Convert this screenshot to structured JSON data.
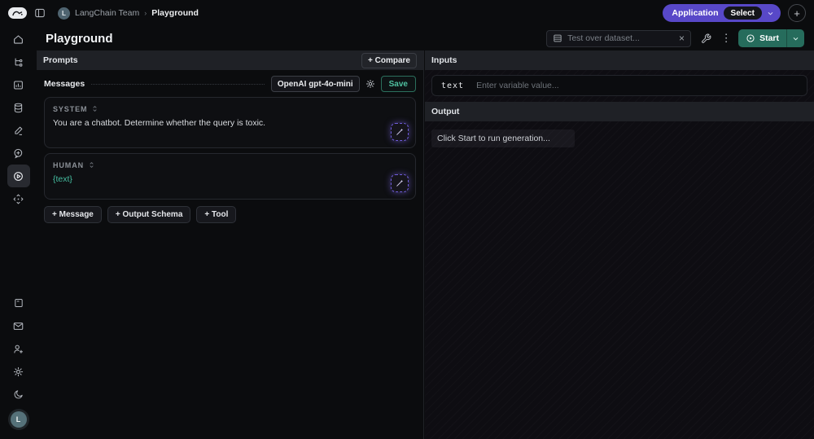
{
  "colors": {
    "accent_purple": "#5848c8",
    "accent_green": "#266c5c",
    "accent_teal": "#45bda0",
    "panel_header_bg": "#1f2126",
    "background": "#0b0c0e"
  },
  "topbar": {
    "breadcrumb": {
      "team_avatar_initial": "L",
      "team": "LangChain Team",
      "separator": "›",
      "current": "Playground"
    },
    "application_button": {
      "label": "Application",
      "select": "Select"
    },
    "add_button": "+"
  },
  "header": {
    "title": "Playground",
    "dataset_input_placeholder": "Test over dataset...",
    "clear_icon": "×",
    "more_icon": "⋮",
    "start_button": "Start"
  },
  "sidebar": {
    "active_item": "playground",
    "user_avatar_initial": "L"
  },
  "prompts_panel": {
    "header": "Prompts",
    "compare_button": "+ Compare",
    "toolbar": {
      "messages_label": "Messages",
      "model_badge": "OpenAI gpt-4o-mini",
      "save_button": "Save"
    },
    "messages": [
      {
        "role": "SYSTEM",
        "content": "You are a chatbot. Determine whether the query is toxic."
      },
      {
        "role": "HUMAN",
        "content": "{text}"
      }
    ],
    "add_buttons": {
      "message": "+ Message",
      "output_schema": "+ Output Schema",
      "tool": "+ Tool"
    }
  },
  "io_panel": {
    "inputs_header": "Inputs",
    "variable": {
      "name": "text",
      "placeholder": "Enter variable value..."
    },
    "output_header": "Output",
    "output_placeholder": "Click Start to run generation..."
  }
}
